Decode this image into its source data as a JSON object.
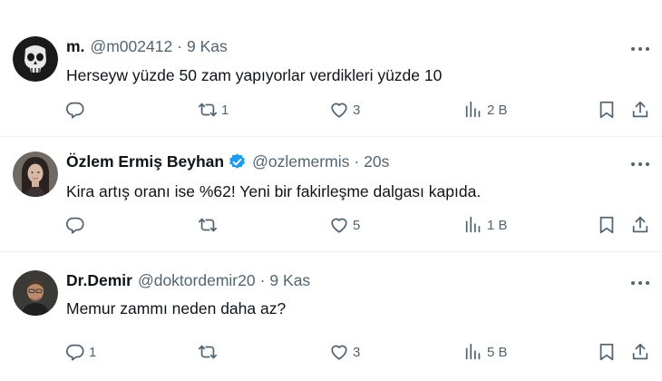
{
  "tweets": [
    {
      "name": "m.",
      "handle": "@m002412",
      "separator": "·",
      "time": "9 Kas",
      "verified": false,
      "avatar": "punisher-skull-avatar",
      "text": "Herseyw yüzde 50 zam yapıyorlar verdikleri yüzde 10",
      "replies": "",
      "retweets": "1",
      "likes": "3",
      "views": "2 B"
    },
    {
      "name": "Özlem Ermiş Beyhan",
      "handle": "@ozlemermis",
      "separator": "·",
      "time": "20s",
      "verified": true,
      "avatar": "woman-portrait-avatar",
      "text": "Kira artış oranı ise %62! Yeni bir fakirleşme dalgası kapıda.",
      "replies": "",
      "retweets": "",
      "likes": "5",
      "views": "1 B"
    },
    {
      "name": "Dr.Demir",
      "handle": "@doktordemir20",
      "separator": "·",
      "time": "9 Kas",
      "verified": false,
      "avatar": "man-portrait-avatar",
      "text": "Memur zammı neden daha az?",
      "replies": "1",
      "retweets": "",
      "likes": "3",
      "views": "5 B"
    }
  ],
  "icons": {
    "reply": "reply-icon",
    "retweet": "retweet-icon",
    "like": "heart-icon",
    "views": "views-icon",
    "bookmark": "bookmark-icon",
    "share": "share-icon",
    "more": "more-icon",
    "verified": "verified-badge-icon"
  },
  "colors": {
    "text": "#0f1419",
    "secondary": "#536471",
    "divider": "#eff3f4",
    "verified": "#1d9bf0"
  }
}
